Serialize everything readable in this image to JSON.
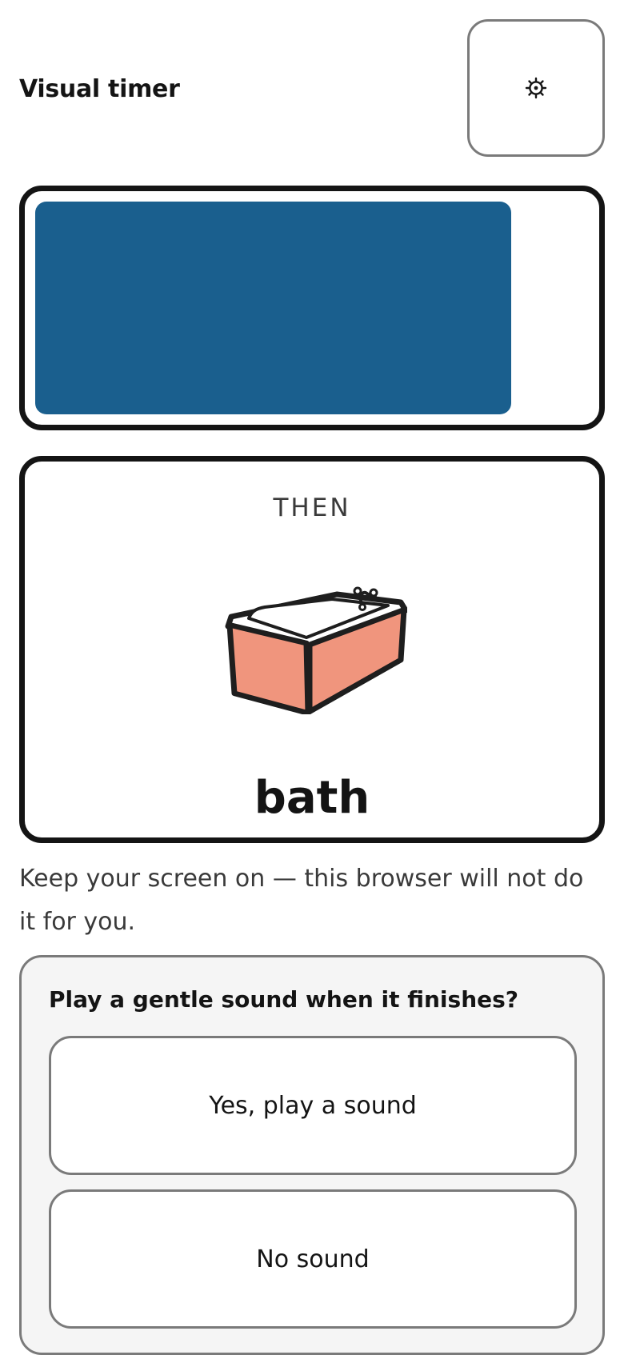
{
  "app": {
    "title": "Visual timer"
  },
  "settings_button": {
    "icon": "gear-icon",
    "label": "⚙"
  },
  "timer": {
    "remaining_fraction": 0.86,
    "fill_color": "#1a5f8e"
  },
  "then_card": {
    "label": "THEN",
    "icon": "bath-icon",
    "activity": "bath",
    "icon_colors": {
      "tub_side": "#f0957d",
      "outline": "#1e1e1e"
    }
  },
  "screen_note": "Keep your screen on — this browser will not do it for you.",
  "sound_prompt": {
    "question": "Play a gentle sound when it finishes?",
    "options": [
      {
        "label": "Yes, play a sound"
      },
      {
        "label": "No sound"
      }
    ]
  }
}
